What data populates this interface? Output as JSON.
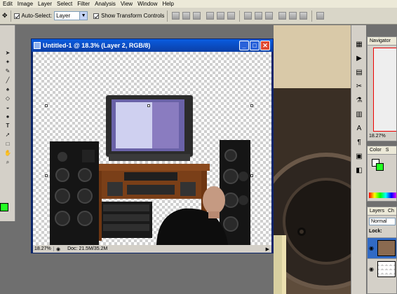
{
  "menu": [
    "Edit",
    "Image",
    "Layer",
    "Select",
    "Filter",
    "Analysis",
    "View",
    "Window",
    "Help"
  ],
  "options": {
    "auto_select_label": "Auto-Select:",
    "auto_select_value": "Layer",
    "show_transform_label": "Show Transform Controls"
  },
  "document": {
    "title": "Untitled-1 @ 18.3% (Layer 2, RGB/8)",
    "status_zoom": "18.27%",
    "status_info": "Doc: 21.5M/35.2M",
    "min_button": "_",
    "max_button": "□",
    "close_button": "✕"
  },
  "navigator": {
    "tab": "Navigator",
    "zoom": "18.27%"
  },
  "color_panel": {
    "tab": "Color",
    "tab2": "S"
  },
  "layers_panel": {
    "tab": "Layers",
    "tab2": "Ch",
    "blend_mode": "Normal",
    "lock_label": "Lock:"
  },
  "colors": {
    "foreground": "#22ff22",
    "title_blue": "#0a5ce0",
    "close_red": "#e0492f"
  },
  "icons": {
    "toolbox": [
      "move-icon",
      "marquee-icon",
      "lasso-icon",
      "magic-wand-icon",
      "crop-icon",
      "eyedropper-icon",
      "brush-icon",
      "stamp-icon",
      "eraser-icon",
      "bucket-icon",
      "dodge-icon",
      "text-icon",
      "pen-icon",
      "shape-icon",
      "hand-icon",
      "zoom-icon"
    ],
    "strip": [
      "navigator-icon",
      "info-icon",
      "histogram-icon",
      "tools-icon",
      "actions-icon",
      "history-icon",
      "character-icon",
      "paragraph-icon"
    ]
  }
}
